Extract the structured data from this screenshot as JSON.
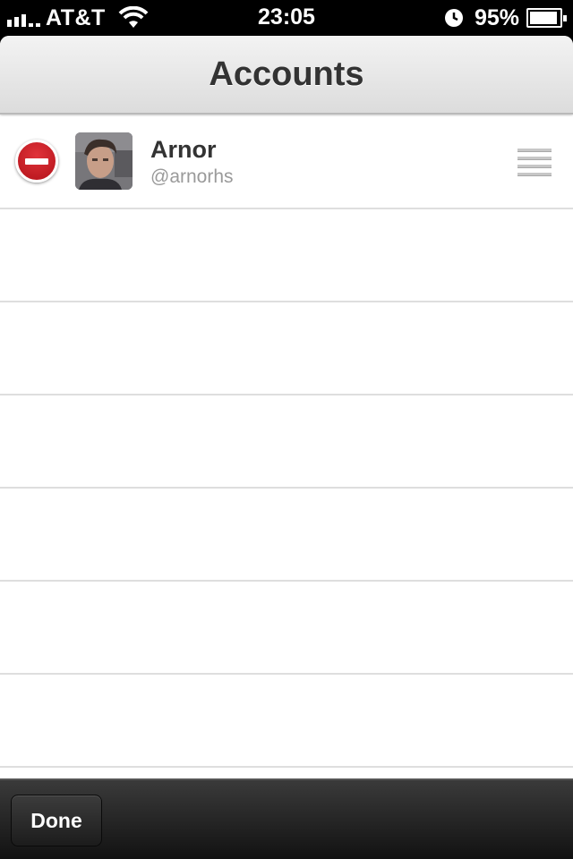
{
  "status_bar": {
    "carrier": "AT&T",
    "time": "23:05",
    "battery_percent_label": "95%",
    "battery_level": 0.95,
    "icons": [
      "signal-icon",
      "wifi-icon",
      "alarm-icon",
      "battery-icon"
    ]
  },
  "nav": {
    "title": "Accounts"
  },
  "accounts": [
    {
      "name": "Arnor",
      "handle": "@arnorhs"
    }
  ],
  "toolbar": {
    "done_label": "Done"
  },
  "colors": {
    "delete_red": "#c8202a",
    "title_text": "#333333",
    "handle_text": "#9a9a9a",
    "toolbar_dark": "#1e1e1e"
  }
}
